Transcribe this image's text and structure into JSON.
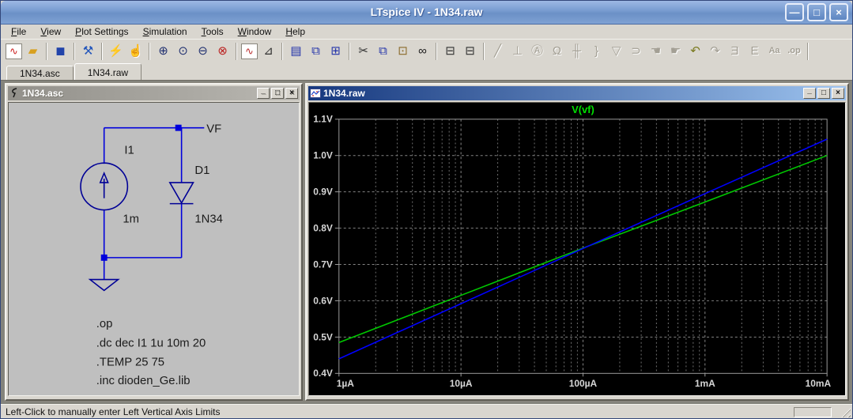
{
  "window": {
    "title": "LTspice IV - 1N34.raw",
    "controls": {
      "minimize": "—",
      "maximize": "□",
      "close": "×"
    }
  },
  "menubar": {
    "items": [
      "File",
      "View",
      "Plot Settings",
      "Simulation",
      "Tools",
      "Window",
      "Help"
    ]
  },
  "toolbar": {
    "groups": [
      [
        {
          "name": "new-schematic",
          "glyph": "∿",
          "color": "#cc2222",
          "boxed": true
        },
        {
          "name": "open-file",
          "glyph": "▰",
          "color": "#d8a020"
        }
      ],
      [
        {
          "name": "save",
          "glyph": "◼",
          "color": "#2244aa"
        }
      ],
      [
        {
          "name": "control-panel",
          "glyph": "⚒",
          "color": "#2255bb"
        }
      ],
      [
        {
          "name": "run-simulation",
          "glyph": "⚡",
          "color": "#303030"
        },
        {
          "name": "halt-simulation",
          "glyph": "☝",
          "disabled": true
        }
      ],
      [
        {
          "name": "zoom-area",
          "glyph": "⊕",
          "color": "#203070"
        },
        {
          "name": "zoom-back",
          "glyph": "⊙",
          "color": "#203070"
        },
        {
          "name": "zoom-out",
          "glyph": "⊖",
          "color": "#203070"
        },
        {
          "name": "zoom-full-extents",
          "glyph": "⊗",
          "color": "#bb2020"
        }
      ],
      [
        {
          "name": "autorange-y-axis",
          "glyph": "∿",
          "color": "#bb3030",
          "boxed": true
        },
        {
          "name": "plot-settings-pane",
          "glyph": "⊿",
          "color": "#303030"
        }
      ],
      [
        {
          "name": "tile-horizontal",
          "glyph": "▤",
          "color": "#2233aa"
        },
        {
          "name": "cascade-windows",
          "glyph": "⧉",
          "color": "#2233aa"
        },
        {
          "name": "tile-vertical",
          "glyph": "⊞",
          "color": "#2233aa"
        }
      ],
      [
        {
          "name": "cut",
          "glyph": "✂",
          "color": "#303030"
        },
        {
          "name": "copy",
          "glyph": "⧉",
          "color": "#2233aa"
        },
        {
          "name": "paste",
          "glyph": "⊡",
          "color": "#8a6a2a"
        },
        {
          "name": "find",
          "glyph": "∞",
          "color": "#1a1a1a"
        }
      ],
      [
        {
          "name": "print-preview",
          "glyph": "⊟",
          "color": "#303030"
        },
        {
          "name": "print",
          "glyph": "⊟",
          "color": "#303030"
        }
      ],
      [
        {
          "name": "draw-wire",
          "glyph": "╱",
          "disabled": true
        },
        {
          "name": "place-ground",
          "glyph": "⊥",
          "disabled": true
        },
        {
          "name": "place-net-label",
          "glyph": "Ⓐ",
          "disabled": true
        },
        {
          "name": "place-resistor",
          "glyph": "Ω",
          "disabled": true
        },
        {
          "name": "place-capacitor",
          "glyph": "╫",
          "disabled": true
        },
        {
          "name": "place-inductor",
          "glyph": "}",
          "disabled": true
        },
        {
          "name": "place-diode",
          "glyph": "▽",
          "disabled": true
        },
        {
          "name": "place-component",
          "glyph": "⊃",
          "disabled": true
        },
        {
          "name": "move",
          "glyph": "☚",
          "disabled": true
        },
        {
          "name": "drag",
          "glyph": "☛",
          "disabled": true
        },
        {
          "name": "undo",
          "glyph": "↶",
          "color": "#7a7a20"
        },
        {
          "name": "redo",
          "glyph": "↷",
          "disabled": true
        },
        {
          "name": "mirror",
          "glyph": "Ǝ",
          "disabled": true
        },
        {
          "name": "rotate",
          "glyph": "E",
          "disabled": true
        },
        {
          "name": "place-text",
          "glyph": "Aa",
          "small": true,
          "disabled": true
        },
        {
          "name": "spice-directive",
          "glyph": ".op",
          "small": true,
          "disabled": true
        }
      ]
    ]
  },
  "tabs": [
    {
      "label": "1N34.asc",
      "active": false
    },
    {
      "label": "1N34.raw",
      "active": true
    }
  ],
  "schematic_window": {
    "title": "1N34.asc",
    "labels": {
      "net": "VF",
      "source_ref": "I1",
      "source_value": "1m",
      "diode_ref": "D1",
      "diode_value": "1N34"
    },
    "directives": [
      ".op",
      ".dc dec I1 1u 10m 20",
      ".TEMP  25 75",
      ".inc dioden_Ge.lib"
    ],
    "controls": {
      "minimize": "_",
      "maximize": "□",
      "close": "×"
    }
  },
  "plot_window": {
    "title": "1N34.raw",
    "controls": {
      "minimize": "_",
      "maximize": "□",
      "close": "×"
    }
  },
  "chart_data": {
    "type": "line",
    "title": "V(vf)",
    "title_color": "#00e000",
    "x_scale": "log",
    "xlim": [
      1e-06,
      0.01
    ],
    "ylim": [
      0.4,
      1.1
    ],
    "grid": true,
    "legend_position": "top-center",
    "x_tick_values": [
      1e-06,
      1e-05,
      0.0001,
      0.001,
      0.01
    ],
    "x_ticks": [
      "1µA",
      "10µA",
      "100µA",
      "1mA",
      "10mA"
    ],
    "y_tick_values": [
      1.1,
      1.0,
      0.9,
      0.8,
      0.7,
      0.6,
      0.5,
      0.4
    ],
    "y_ticks": [
      "1.1V",
      "1.0V",
      "0.9V",
      "0.8V",
      "0.7V",
      "0.6V",
      "0.5V",
      "0.4V"
    ],
    "series": [
      {
        "name": "V(vf)",
        "color": "#00c800",
        "x": [
          1e-06,
          1e-05,
          0.0001,
          0.001,
          0.01
        ],
        "y": [
          0.485,
          0.615,
          0.745,
          0.872,
          1.0
        ]
      },
      {
        "name": "V(vf)",
        "color": "#0000ff",
        "x": [
          1e-06,
          1e-05,
          0.0001,
          0.001,
          0.01
        ],
        "y": [
          0.44,
          0.592,
          0.744,
          0.895,
          1.045
        ]
      }
    ]
  },
  "statusbar": {
    "text": "Left-Click to manually enter Left Vertical Axis Limits"
  }
}
